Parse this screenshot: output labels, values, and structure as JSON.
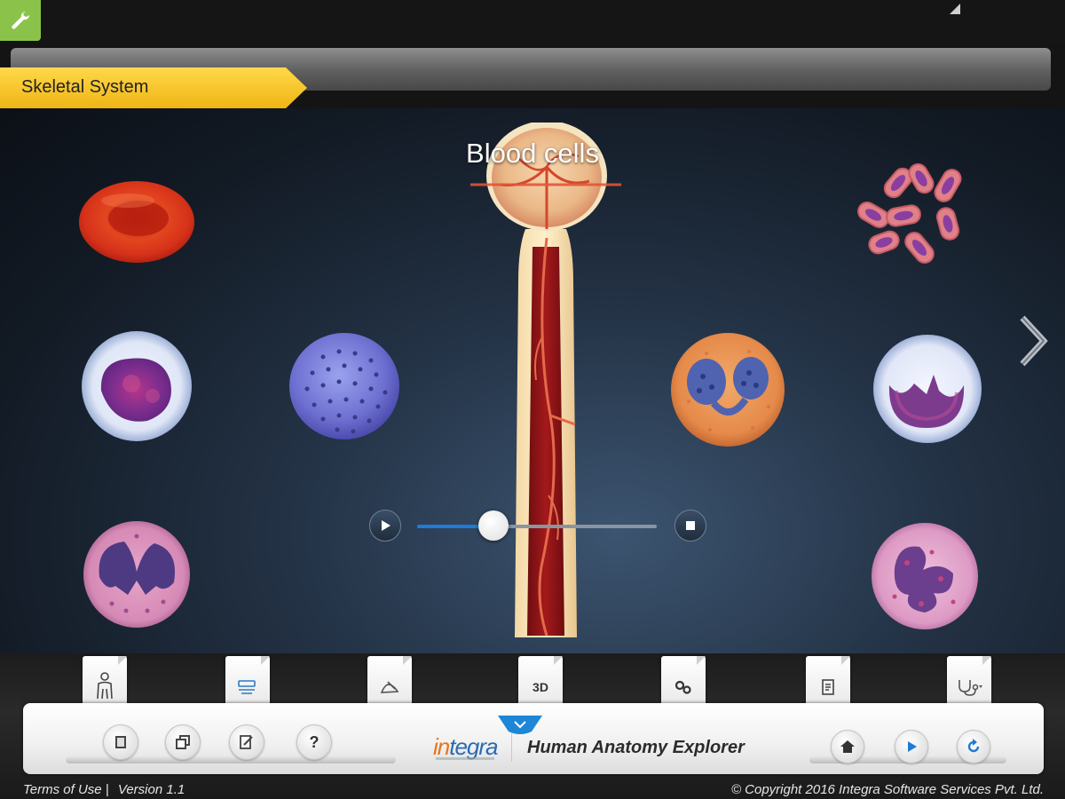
{
  "section": {
    "label": "Skeletal System"
  },
  "stage": {
    "title": "Blood cells",
    "playback": {
      "progress": 0.32
    },
    "cells": [
      {
        "name": "red-blood-cell"
      },
      {
        "name": "platelets"
      },
      {
        "name": "monocyte"
      },
      {
        "name": "lymphocyte"
      },
      {
        "name": "eosinophil"
      },
      {
        "name": "basophil"
      },
      {
        "name": "neutrophil"
      },
      {
        "name": "bone-marrow-bone"
      }
    ]
  },
  "tabs": [
    {
      "name": "body-icon"
    },
    {
      "name": "layers-icon"
    },
    {
      "name": "draw-icon"
    },
    {
      "name": "3d",
      "label": "3D"
    },
    {
      "name": "gears-icon"
    },
    {
      "name": "notes-icon"
    },
    {
      "name": "stethoscope-icon"
    }
  ],
  "toolbar": {
    "left_buttons": [
      {
        "name": "book-icon"
      },
      {
        "name": "gallery-icon"
      },
      {
        "name": "edit-icon"
      },
      {
        "name": "help-icon",
        "label": "?"
      }
    ],
    "right_buttons": [
      {
        "name": "home-icon"
      },
      {
        "name": "play-icon"
      },
      {
        "name": "refresh-icon"
      }
    ]
  },
  "brand": {
    "logo_prefix": "in",
    "logo_rest": "tegra",
    "app_name": "Human Anatomy Explorer"
  },
  "footer": {
    "terms": "Terms of Use |",
    "version": "Version 1.1",
    "copyright": "© Copyright 2016 Integra Software Services Pvt. Ltd."
  },
  "colors": {
    "tools_green": "#8bc34a",
    "section_yellow": "#f5c21e",
    "slider_blue": "#1e7bd6",
    "logo_orange": "#e8731a",
    "logo_blue": "#2a6bb0"
  }
}
